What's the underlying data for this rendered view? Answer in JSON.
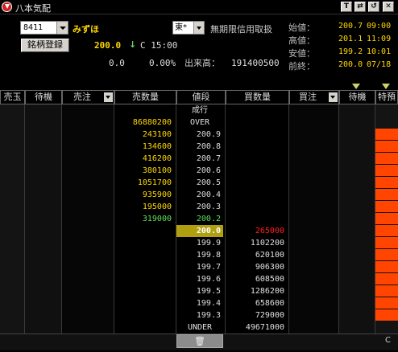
{
  "window": {
    "title": "八本気配",
    "buttons": [
      "T",
      "⇄",
      "↺",
      "✕"
    ]
  },
  "header": {
    "code": "8411",
    "stock_name": "みずほ",
    "market": "東*",
    "credit_label": "無期限信用取扱",
    "register_button": "銘柄登録",
    "price": "200.0",
    "arrow": "↓",
    "price_flag": "C",
    "price_time": "15:00",
    "change": "0.0",
    "change_pct": "0.00%",
    "volume_label": "出来高：",
    "volume": "191400500",
    "ohlc": [
      {
        "label": "始値：",
        "value": "200.7",
        "time": "09:00"
      },
      {
        "label": "高値：",
        "value": "201.1",
        "time": "11:09"
      },
      {
        "label": "安値：",
        "value": "199.2",
        "time": "10:01"
      },
      {
        "label": "前終：",
        "value": "200.0",
        "time": "07/18"
      }
    ]
  },
  "columns": [
    "売玉",
    "待機",
    "売注",
    "売数量",
    "値段",
    "買数量",
    "買注",
    "待機",
    "特預"
  ],
  "board": {
    "market_order_label": "成行",
    "over": {
      "price_label": "OVER",
      "qty": "86880200"
    },
    "asks": [
      {
        "price": "200.9",
        "qty": "243100"
      },
      {
        "price": "200.8",
        "qty": "134600"
      },
      {
        "price": "200.7",
        "qty": "416200"
      },
      {
        "price": "200.6",
        "qty": "380100"
      },
      {
        "price": "200.5",
        "qty": "1051700"
      },
      {
        "price": "200.4",
        "qty": "935900"
      },
      {
        "price": "200.3",
        "qty": "195000"
      },
      {
        "price": "200.2",
        "qty": "319000"
      }
    ],
    "bids": [
      {
        "price": "200.0",
        "qty": "265000"
      },
      {
        "price": "199.9",
        "qty": "1102200"
      },
      {
        "price": "199.8",
        "qty": "620100"
      },
      {
        "price": "199.7",
        "qty": "906300"
      },
      {
        "price": "199.6",
        "qty": "608500"
      },
      {
        "price": "199.5",
        "qty": "1286200"
      },
      {
        "price": "199.4",
        "qty": "658600"
      },
      {
        "price": "199.3",
        "qty": "729000"
      }
    ],
    "under": {
      "price_label": "UNDER",
      "qty": "49671000"
    },
    "trash_icon": "🗑",
    "corner_label": "C"
  },
  "colors": {
    "ask_qty": "#ffd700",
    "bid_qty": "#ff2020",
    "last_trade": "#5de05d",
    "current_price_bg": "#b0a010",
    "reserve": "#ff4500"
  }
}
